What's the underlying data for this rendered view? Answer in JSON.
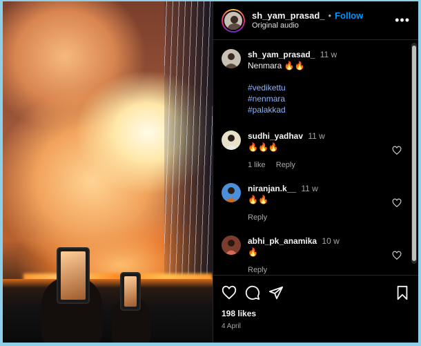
{
  "post": {
    "username": "sh_yam_prasad_",
    "dot": "•",
    "follow_label": "Follow",
    "audio": "Original audio",
    "more_icon": "more-horizontal-icon"
  },
  "caption": {
    "username": "sh_yam_prasad_",
    "time": "11 w",
    "text": "Nenmara 🔥🔥",
    "hashtags": [
      "#vedikettu",
      "#nenmara",
      "#palakkad"
    ]
  },
  "comments": [
    {
      "username": "sudhi_yadhav",
      "time": "11 w",
      "text": "🔥🔥🔥",
      "likes": "1 like",
      "reply": "Reply"
    },
    {
      "username": "niranjan.k__",
      "time": "11 w",
      "text": "🔥🔥",
      "reply": "Reply"
    },
    {
      "username": "abhi_pk_anamika",
      "time": "10 w",
      "text": "🔥",
      "reply": "Reply"
    }
  ],
  "footer": {
    "likes": "198 likes",
    "date": "4 April",
    "icons": [
      "heart-icon",
      "comment-icon",
      "share-icon",
      "bookmark-icon"
    ]
  },
  "colors": {
    "background": "#000000",
    "accent": "#0095f6",
    "hashtag": "#8ab4ff",
    "muted": "#a8a8a8",
    "frame": "#8fd0e8"
  }
}
